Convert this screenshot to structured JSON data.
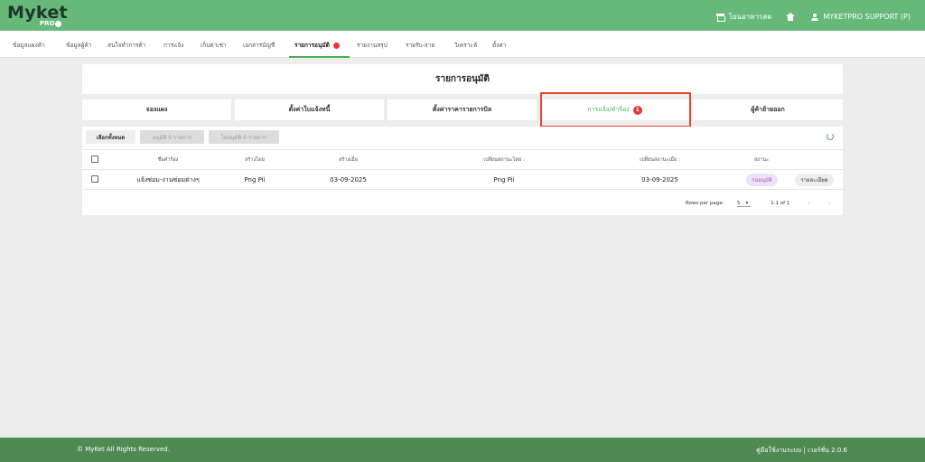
{
  "app": {
    "logo": "Myket",
    "logo_sub": "PRO",
    "store_name": "โยนอาหารสด",
    "user_name": "MYKETPRO SUPPORT (P)",
    "accent_color": "#67b97a"
  },
  "nav": {
    "items": [
      {
        "label": "ข้อมูลแผงค้า"
      },
      {
        "label": "ข้อมูลผู้ค้า"
      },
      {
        "label": "สนใจทำการค้า"
      },
      {
        "label": "การแจ้ง"
      },
      {
        "label": "เก็บค่าเช่า"
      },
      {
        "label": "เอกสารบัญชี"
      },
      {
        "label": "รายการอนุมัติ"
      },
      {
        "label": "รายงานสรุป"
      },
      {
        "label": "รายรับ-จ่าย"
      },
      {
        "label": "วิเคราะห์"
      },
      {
        "label": "ตั้งค่า"
      }
    ],
    "active": "รายการอนุมัติ"
  },
  "page": {
    "title": "รายการอนุมัติ"
  },
  "tabs": [
    {
      "label": "จองแผง"
    },
    {
      "label": "ตั้งค่าใบแจ้งหนี้"
    },
    {
      "label": "ตั้งค่าราคารายการบิล"
    },
    {
      "label": "การแจ้ง/คำร้อง",
      "badge": "1"
    },
    {
      "label": "ผู้ค้าย้ายออก"
    }
  ],
  "toolbar": {
    "select_all": "เลือกทั้งหมด",
    "approve": "อนุมัติ 0 รายการ",
    "reject": "ไม่อนุมัติ 0 รายการ"
  },
  "table": {
    "headers": [
      "ชื่อคำร้อง",
      "สร้างโดย",
      "สร้างเมื่อ",
      "เปลี่ยนสถานะโดย :",
      "เปลี่ยนสถานะเมื่อ :",
      "สถานะ"
    ],
    "rows": [
      {
        "name": "แจ้งซ่อม-งานซ่อมต่างๆ",
        "created_by": "Png Pii",
        "created_at": "03-09-2025",
        "changed_by": "Png Pii",
        "changed_at": "03-09-2025",
        "status": "รออนุมัติ",
        "action": "รายละเอียด"
      }
    ]
  },
  "pager": {
    "rows_per_page_label": "Rows per page:",
    "rows_per_page": "5",
    "range": "1-1 of 1"
  },
  "footer": {
    "copyright": "© MyKet All Rights Reserved.",
    "right": "คู่มือใช้งานระบบ | เวอร์ชั่น 2.0.6"
  }
}
